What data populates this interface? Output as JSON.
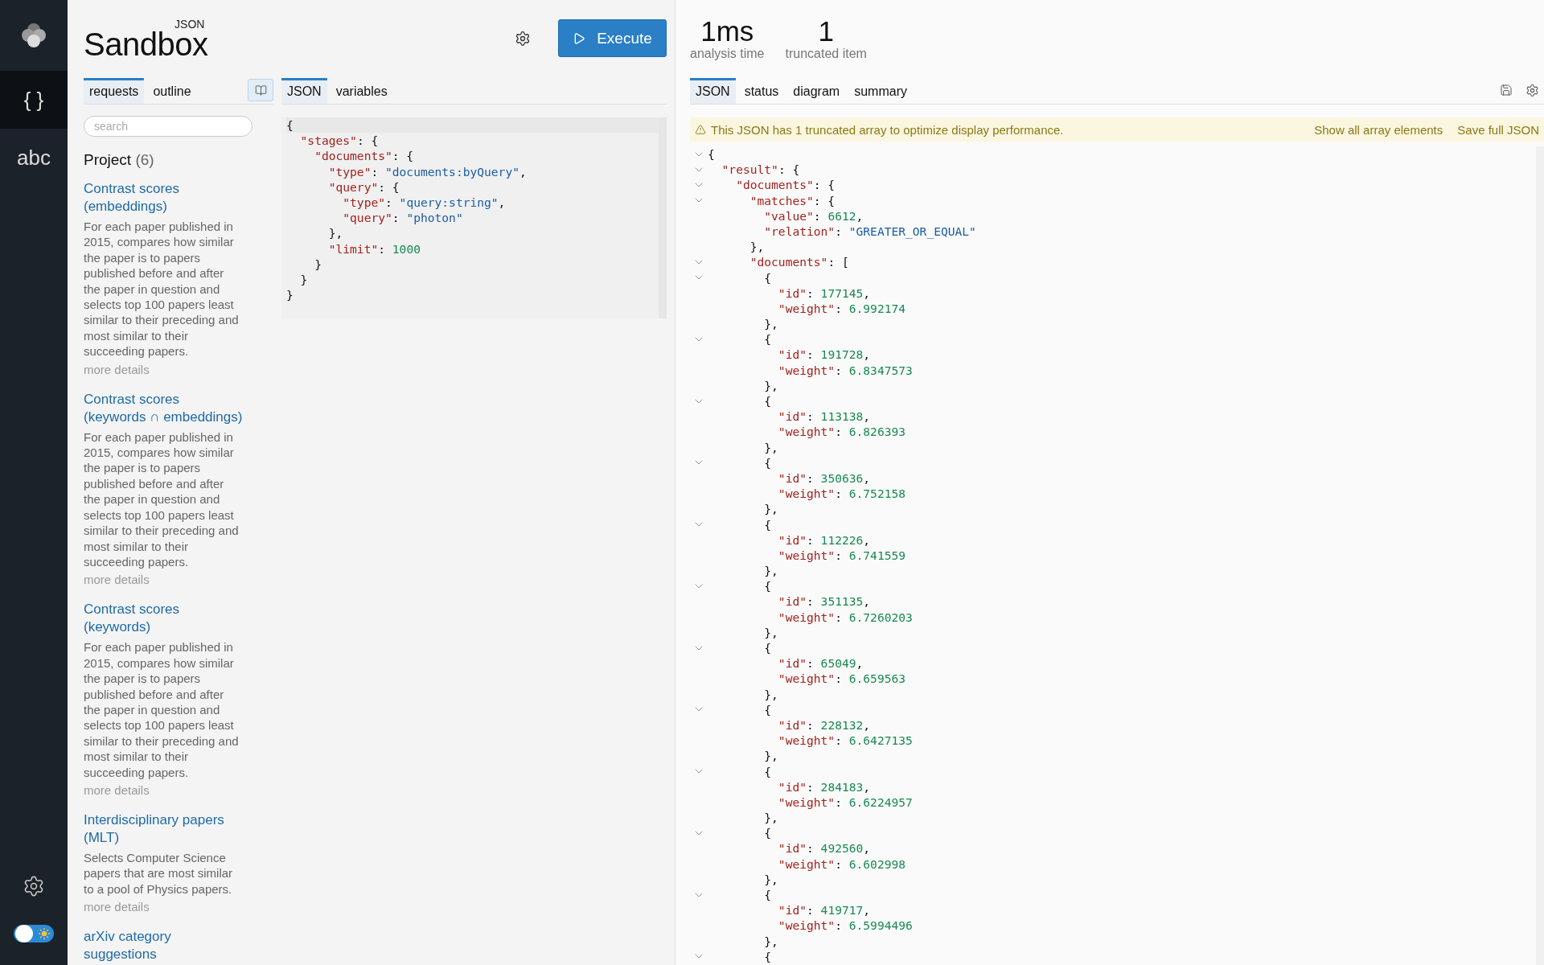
{
  "rail": {
    "items": [
      {
        "label": "{ }",
        "selected": true
      },
      {
        "label": "abc",
        "selected": false
      }
    ],
    "theme_toggle": {
      "dark_mode": false
    }
  },
  "header": {
    "logo": {
      "title": "Sandbox",
      "superscript": "JSON"
    },
    "execute": "Execute"
  },
  "sidebar": {
    "tabs": [
      {
        "label": "requests",
        "selected": true
      },
      {
        "label": "outline",
        "selected": false
      }
    ],
    "search": {
      "placeholder": "search"
    },
    "project": {
      "title": "Project",
      "count": "(6)"
    },
    "items": [
      {
        "title": "Contrast scores (embeddings)",
        "description": "For each paper published in 2015, compares how similar the paper is to papers published before and after the paper in question and selects top 100 papers least similar to their preceding and most similar to their succeeding papers.",
        "link": "more details"
      },
      {
        "title": "Contrast scores (keywords ∩ embeddings)",
        "description": "For each paper published in 2015, compares how similar the paper is to papers published before and after the paper in question and selects top 100 papers least similar to their preceding and most similar to their succeeding papers.",
        "link": "more details"
      },
      {
        "title": "Contrast scores (keywords)",
        "description": "For each paper published in 2015, compares how similar the paper is to papers published before and after the paper in question and selects top 100 papers least similar to their preceding and most similar to their succeeding papers.",
        "link": "more details"
      },
      {
        "title": "Interdisciplinary papers (MLT)",
        "description": "Selects Computer Science papers that are most similar to a pool of Physics papers.",
        "link": "more details"
      },
      {
        "title": "arXiv category suggestions"
      }
    ]
  },
  "editor": {
    "tabs": [
      {
        "label": "JSON",
        "selected": true
      },
      {
        "label": "variables",
        "selected": false
      }
    ],
    "lines": [
      [
        {
          "kind": "p",
          "text": "{"
        }
      ],
      [
        {
          "kind": "key",
          "text": "  \"stages\""
        },
        {
          "kind": "p",
          "text": ": {"
        }
      ],
      [
        {
          "kind": "key",
          "text": "    \"documents\""
        },
        {
          "kind": "p",
          "text": ": {"
        }
      ],
      [
        {
          "kind": "key",
          "text": "      \"type\""
        },
        {
          "kind": "p",
          "text": ": "
        },
        {
          "kind": "str",
          "text": "\"documents:byQuery\""
        },
        {
          "kind": "p",
          "text": ","
        }
      ],
      [
        {
          "kind": "key",
          "text": "      \"query\""
        },
        {
          "kind": "p",
          "text": ": {"
        }
      ],
      [
        {
          "kind": "key",
          "text": "        \"type\""
        },
        {
          "kind": "p",
          "text": ": "
        },
        {
          "kind": "str",
          "text": "\"query:string\""
        },
        {
          "kind": "p",
          "text": ","
        }
      ],
      [
        {
          "kind": "key",
          "text": "        \"query\""
        },
        {
          "kind": "p",
          "text": ": "
        },
        {
          "kind": "str",
          "text": "\"photon\""
        }
      ],
      [
        {
          "kind": "p",
          "text": "      },"
        }
      ],
      [
        {
          "kind": "key",
          "text": "      \"limit\""
        },
        {
          "kind": "p",
          "text": ": "
        },
        {
          "kind": "num",
          "text": "1000"
        }
      ],
      [
        {
          "kind": "p",
          "text": "    }"
        }
      ],
      [
        {
          "kind": "p",
          "text": "  }"
        }
      ],
      [
        {
          "kind": "p",
          "text": "}"
        }
      ]
    ]
  },
  "result": {
    "stats": [
      {
        "value": "1ms",
        "label": "analysis time"
      },
      {
        "value": "1",
        "label": "truncated item"
      }
    ],
    "tabs": [
      {
        "label": "JSON",
        "selected": true
      },
      {
        "label": "status",
        "selected": false
      },
      {
        "label": "diagram",
        "selected": false
      },
      {
        "label": "summary",
        "selected": false
      }
    ],
    "banner": {
      "message": "This JSON has 1 truncated array to optimize display performance.",
      "actions": [
        "Show all array elements",
        "Save full JSON"
      ]
    },
    "lines": [
      {
        "foldable": true,
        "tokens": [
          {
            "kind": "p",
            "text": "{"
          }
        ]
      },
      {
        "foldable": true,
        "tokens": [
          {
            "kind": "key",
            "text": "  \"result\""
          },
          {
            "kind": "p",
            "text": ": {"
          }
        ]
      },
      {
        "foldable": true,
        "tokens": [
          {
            "kind": "key",
            "text": "    \"documents\""
          },
          {
            "kind": "p",
            "text": ": {"
          }
        ]
      },
      {
        "foldable": true,
        "tokens": [
          {
            "kind": "key",
            "text": "      \"matches\""
          },
          {
            "kind": "p",
            "text": ": {"
          }
        ]
      },
      {
        "foldable": false,
        "tokens": [
          {
            "kind": "key",
            "text": "        \"value\""
          },
          {
            "kind": "p",
            "text": ": "
          },
          {
            "kind": "num",
            "text": "6612"
          },
          {
            "kind": "p",
            "text": ","
          }
        ]
      },
      {
        "foldable": false,
        "tokens": [
          {
            "kind": "key",
            "text": "        \"relation\""
          },
          {
            "kind": "p",
            "text": ": "
          },
          {
            "kind": "str",
            "text": "\"GREATER_OR_EQUAL\""
          }
        ]
      },
      {
        "foldable": false,
        "tokens": [
          {
            "kind": "p",
            "text": "      },"
          }
        ]
      },
      {
        "foldable": true,
        "tokens": [
          {
            "kind": "key",
            "text": "      \"documents\""
          },
          {
            "kind": "p",
            "text": ": ["
          }
        ]
      },
      {
        "foldable": true,
        "tokens": [
          {
            "kind": "p",
            "text": "        {"
          }
        ]
      },
      {
        "foldable": false,
        "tokens": [
          {
            "kind": "key",
            "text": "          \"id\""
          },
          {
            "kind": "p",
            "text": ": "
          },
          {
            "kind": "num",
            "text": "177145"
          },
          {
            "kind": "p",
            "text": ","
          }
        ]
      },
      {
        "foldable": false,
        "tokens": [
          {
            "kind": "key",
            "text": "          \"weight\""
          },
          {
            "kind": "p",
            "text": ": "
          },
          {
            "kind": "num",
            "text": "6.992174"
          }
        ]
      },
      {
        "foldable": false,
        "tokens": [
          {
            "kind": "p",
            "text": "        },"
          }
        ]
      },
      {
        "foldable": true,
        "tokens": [
          {
            "kind": "p",
            "text": "        {"
          }
        ]
      },
      {
        "foldable": false,
        "tokens": [
          {
            "kind": "key",
            "text": "          \"id\""
          },
          {
            "kind": "p",
            "text": ": "
          },
          {
            "kind": "num",
            "text": "191728"
          },
          {
            "kind": "p",
            "text": ","
          }
        ]
      },
      {
        "foldable": false,
        "tokens": [
          {
            "kind": "key",
            "text": "          \"weight\""
          },
          {
            "kind": "p",
            "text": ": "
          },
          {
            "kind": "num",
            "text": "6.8347573"
          }
        ]
      },
      {
        "foldable": false,
        "tokens": [
          {
            "kind": "p",
            "text": "        },"
          }
        ]
      },
      {
        "foldable": true,
        "tokens": [
          {
            "kind": "p",
            "text": "        {"
          }
        ]
      },
      {
        "foldable": false,
        "tokens": [
          {
            "kind": "key",
            "text": "          \"id\""
          },
          {
            "kind": "p",
            "text": ": "
          },
          {
            "kind": "num",
            "text": "113138"
          },
          {
            "kind": "p",
            "text": ","
          }
        ]
      },
      {
        "foldable": false,
        "tokens": [
          {
            "kind": "key",
            "text": "          \"weight\""
          },
          {
            "kind": "p",
            "text": ": "
          },
          {
            "kind": "num",
            "text": "6.826393"
          }
        ]
      },
      {
        "foldable": false,
        "tokens": [
          {
            "kind": "p",
            "text": "        },"
          }
        ]
      },
      {
        "foldable": true,
        "tokens": [
          {
            "kind": "p",
            "text": "        {"
          }
        ]
      },
      {
        "foldable": false,
        "tokens": [
          {
            "kind": "key",
            "text": "          \"id\""
          },
          {
            "kind": "p",
            "text": ": "
          },
          {
            "kind": "num",
            "text": "350636"
          },
          {
            "kind": "p",
            "text": ","
          }
        ]
      },
      {
        "foldable": false,
        "tokens": [
          {
            "kind": "key",
            "text": "          \"weight\""
          },
          {
            "kind": "p",
            "text": ": "
          },
          {
            "kind": "num",
            "text": "6.752158"
          }
        ]
      },
      {
        "foldable": false,
        "tokens": [
          {
            "kind": "p",
            "text": "        },"
          }
        ]
      },
      {
        "foldable": true,
        "tokens": [
          {
            "kind": "p",
            "text": "        {"
          }
        ]
      },
      {
        "foldable": false,
        "tokens": [
          {
            "kind": "key",
            "text": "          \"id\""
          },
          {
            "kind": "p",
            "text": ": "
          },
          {
            "kind": "num",
            "text": "112226"
          },
          {
            "kind": "p",
            "text": ","
          }
        ]
      },
      {
        "foldable": false,
        "tokens": [
          {
            "kind": "key",
            "text": "          \"weight\""
          },
          {
            "kind": "p",
            "text": ": "
          },
          {
            "kind": "num",
            "text": "6.741559"
          }
        ]
      },
      {
        "foldable": false,
        "tokens": [
          {
            "kind": "p",
            "text": "        },"
          }
        ]
      },
      {
        "foldable": true,
        "tokens": [
          {
            "kind": "p",
            "text": "        {"
          }
        ]
      },
      {
        "foldable": false,
        "tokens": [
          {
            "kind": "key",
            "text": "          \"id\""
          },
          {
            "kind": "p",
            "text": ": "
          },
          {
            "kind": "num",
            "text": "351135"
          },
          {
            "kind": "p",
            "text": ","
          }
        ]
      },
      {
        "foldable": false,
        "tokens": [
          {
            "kind": "key",
            "text": "          \"weight\""
          },
          {
            "kind": "p",
            "text": ": "
          },
          {
            "kind": "num",
            "text": "6.7260203"
          }
        ]
      },
      {
        "foldable": false,
        "tokens": [
          {
            "kind": "p",
            "text": "        },"
          }
        ]
      },
      {
        "foldable": true,
        "tokens": [
          {
            "kind": "p",
            "text": "        {"
          }
        ]
      },
      {
        "foldable": false,
        "tokens": [
          {
            "kind": "key",
            "text": "          \"id\""
          },
          {
            "kind": "p",
            "text": ": "
          },
          {
            "kind": "num",
            "text": "65049"
          },
          {
            "kind": "p",
            "text": ","
          }
        ]
      },
      {
        "foldable": false,
        "tokens": [
          {
            "kind": "key",
            "text": "          \"weight\""
          },
          {
            "kind": "p",
            "text": ": "
          },
          {
            "kind": "num",
            "text": "6.659563"
          }
        ]
      },
      {
        "foldable": false,
        "tokens": [
          {
            "kind": "p",
            "text": "        },"
          }
        ]
      },
      {
        "foldable": true,
        "tokens": [
          {
            "kind": "p",
            "text": "        {"
          }
        ]
      },
      {
        "foldable": false,
        "tokens": [
          {
            "kind": "key",
            "text": "          \"id\""
          },
          {
            "kind": "p",
            "text": ": "
          },
          {
            "kind": "num",
            "text": "228132"
          },
          {
            "kind": "p",
            "text": ","
          }
        ]
      },
      {
        "foldable": false,
        "tokens": [
          {
            "kind": "key",
            "text": "          \"weight\""
          },
          {
            "kind": "p",
            "text": ": "
          },
          {
            "kind": "num",
            "text": "6.6427135"
          }
        ]
      },
      {
        "foldable": false,
        "tokens": [
          {
            "kind": "p",
            "text": "        },"
          }
        ]
      },
      {
        "foldable": true,
        "tokens": [
          {
            "kind": "p",
            "text": "        {"
          }
        ]
      },
      {
        "foldable": false,
        "tokens": [
          {
            "kind": "key",
            "text": "          \"id\""
          },
          {
            "kind": "p",
            "text": ": "
          },
          {
            "kind": "num",
            "text": "284183"
          },
          {
            "kind": "p",
            "text": ","
          }
        ]
      },
      {
        "foldable": false,
        "tokens": [
          {
            "kind": "key",
            "text": "          \"weight\""
          },
          {
            "kind": "p",
            "text": ": "
          },
          {
            "kind": "num",
            "text": "6.6224957"
          }
        ]
      },
      {
        "foldable": false,
        "tokens": [
          {
            "kind": "p",
            "text": "        },"
          }
        ]
      },
      {
        "foldable": true,
        "tokens": [
          {
            "kind": "p",
            "text": "        {"
          }
        ]
      },
      {
        "foldable": false,
        "tokens": [
          {
            "kind": "key",
            "text": "          \"id\""
          },
          {
            "kind": "p",
            "text": ": "
          },
          {
            "kind": "num",
            "text": "492560"
          },
          {
            "kind": "p",
            "text": ","
          }
        ]
      },
      {
        "foldable": false,
        "tokens": [
          {
            "kind": "key",
            "text": "          \"weight\""
          },
          {
            "kind": "p",
            "text": ": "
          },
          {
            "kind": "num",
            "text": "6.602998"
          }
        ]
      },
      {
        "foldable": false,
        "tokens": [
          {
            "kind": "p",
            "text": "        },"
          }
        ]
      },
      {
        "foldable": true,
        "tokens": [
          {
            "kind": "p",
            "text": "        {"
          }
        ]
      },
      {
        "foldable": false,
        "tokens": [
          {
            "kind": "key",
            "text": "          \"id\""
          },
          {
            "kind": "p",
            "text": ": "
          },
          {
            "kind": "num",
            "text": "419717"
          },
          {
            "kind": "p",
            "text": ","
          }
        ]
      },
      {
        "foldable": false,
        "tokens": [
          {
            "kind": "key",
            "text": "          \"weight\""
          },
          {
            "kind": "p",
            "text": ": "
          },
          {
            "kind": "num",
            "text": "6.5994496"
          }
        ]
      },
      {
        "foldable": false,
        "tokens": [
          {
            "kind": "p",
            "text": "        },"
          }
        ]
      },
      {
        "foldable": true,
        "tokens": [
          {
            "kind": "p",
            "text": "        {"
          }
        ]
      }
    ]
  }
}
